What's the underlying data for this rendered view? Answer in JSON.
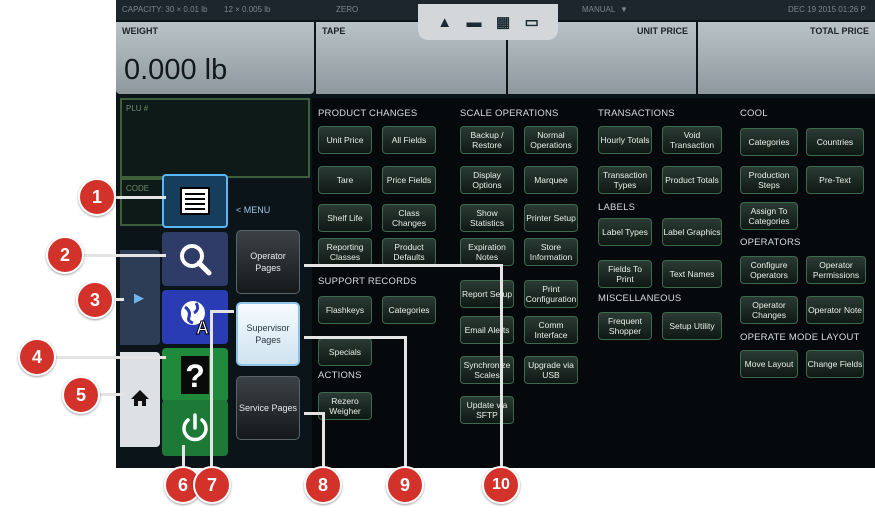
{
  "status_bar": {
    "capacity": "CAPACITY: 30 × 0.01 lb",
    "range": "12 × 0.005 lb",
    "zero": "ZERO",
    "mode": "MANUAL",
    "datetime": "DEC 19 2015 01:26 P"
  },
  "header": {
    "weight_label": "WEIGHT",
    "weight_value": "0.000 lb",
    "tape_label": "TAPE",
    "unit_price_label": "UNIT PRICE",
    "total_price_label": "TOTAL PRICE"
  },
  "plu_label": "PLU #",
  "plu2_label": "CODE",
  "menu": {
    "label": "< MENU",
    "operator_pages": "Operator Pages",
    "supervisor_pages": "Supervisor Pages",
    "service_pages": "Service Pages"
  },
  "sections": {
    "product_changes": {
      "title": "PRODUCT CHANGES",
      "buttons": [
        "Unit Price",
        "All Fields",
        "Tare",
        "Price Fields",
        "Shelf Life",
        "Class Changes",
        "Reporting Classes",
        "Product Defaults"
      ]
    },
    "support_records": {
      "title": "SUPPORT RECORDS",
      "buttons": [
        "Flashkeys",
        "Categories",
        "Specials"
      ]
    },
    "actions": {
      "title": "ACTIONS",
      "buttons": [
        "Rezero Weigher"
      ]
    },
    "scale_operations": {
      "title": "SCALE OPERATIONS",
      "buttons": [
        "Backup / Restore",
        "Normal Operations",
        "Display Options",
        "Marquee",
        "Show Statistics",
        "Printer Setup",
        "Expiration Notes",
        "Store Information",
        "Report Setup",
        "Print Configuration",
        "Email Alerts",
        "Comm Interface",
        "Synchronize Scales",
        "Upgrade via USB",
        "Update via SFTP"
      ]
    },
    "transactions": {
      "title": "TRANSACTIONS",
      "buttons": [
        "Hourly Totals",
        "Void Transaction",
        "Transaction Types",
        "Product Totals"
      ]
    },
    "labels": {
      "title": "LABELS",
      "buttons": [
        "Label Types",
        "Label Graphics",
        "Fields To Print",
        "Text Names"
      ]
    },
    "miscellaneous": {
      "title": "MISCELLANEOUS",
      "buttons": [
        "Frequent Shopper",
        "Setup Utility"
      ]
    },
    "cool": {
      "title": "COOL",
      "buttons": [
        "Categories",
        "Countries",
        "Production Steps",
        "Pre-Text",
        "Assign To Categories"
      ]
    },
    "operators": {
      "title": "OPERATORS",
      "buttons": [
        "Configure Operators",
        "Operator Permissions",
        "Operator Changes",
        "Operator Note"
      ]
    },
    "operate_mode_layout": {
      "title": "OPERATE MODE LAYOUT",
      "buttons": [
        "Move Layout",
        "Change Fields"
      ]
    }
  },
  "callouts": [
    "1",
    "2",
    "3",
    "4",
    "5",
    "6",
    "7",
    "8",
    "9",
    "10"
  ],
  "icons": {
    "list": "list-icon",
    "search": "magnifier-icon",
    "language": "globe-language-icon",
    "help": "question-icon",
    "home": "home-icon",
    "power": "power-icon",
    "arrow": "chevron-right-icon"
  },
  "colors": {
    "callout": "#d3322b",
    "button_border": "#3c6a4e",
    "selected": "#8fc4e8"
  }
}
